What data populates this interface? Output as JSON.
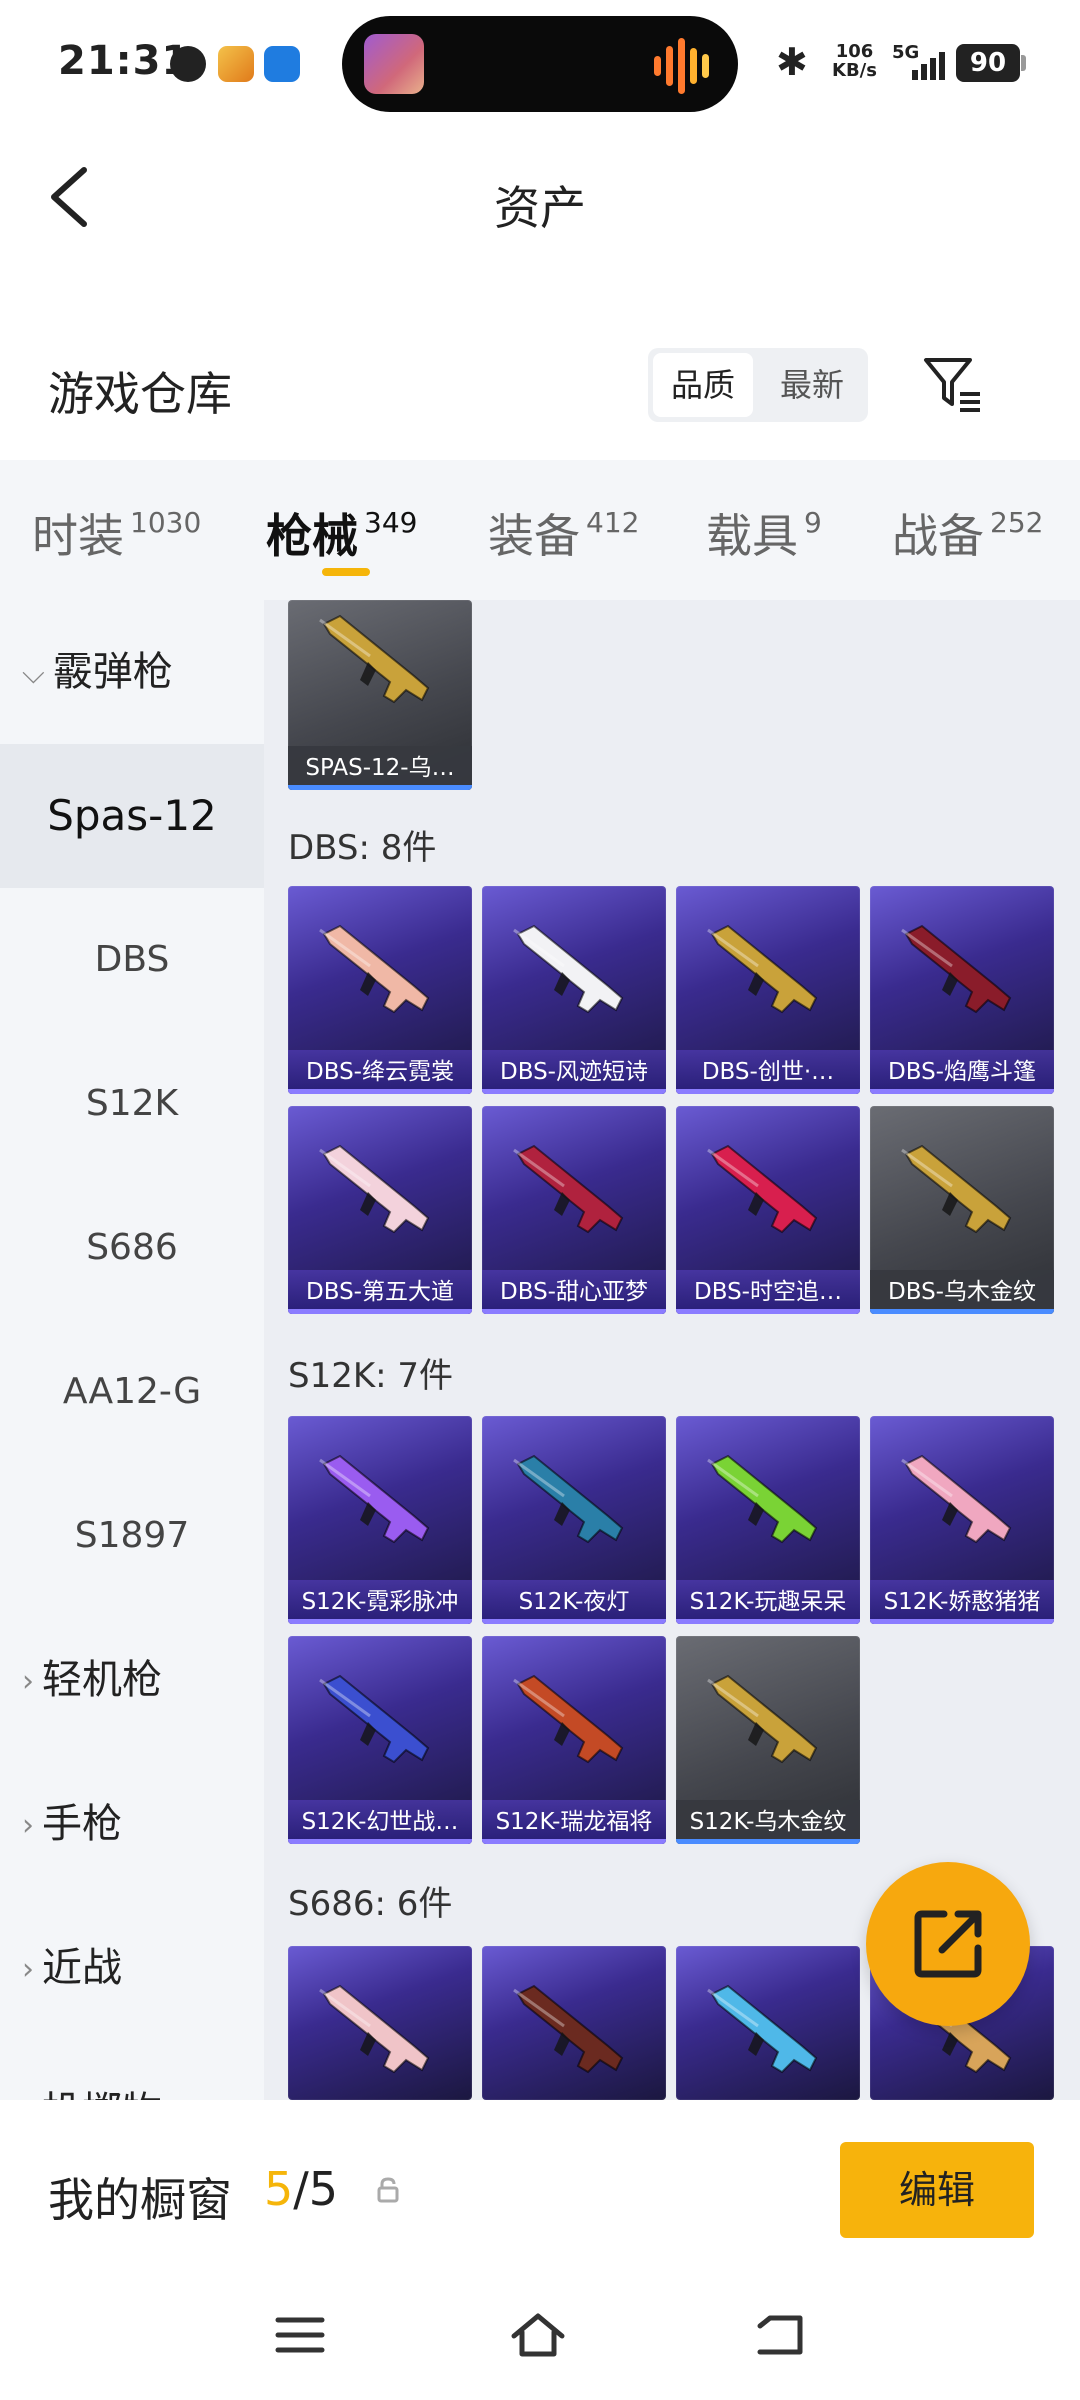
{
  "status_bar": {
    "time": "21:31",
    "speed_value": "106",
    "speed_unit": "KB/s",
    "network": "5G",
    "battery": "90"
  },
  "header": {
    "title": "资产"
  },
  "warehouse": {
    "title": "游戏仓库",
    "sort_options": [
      "品质",
      "最新"
    ],
    "active_sort": "品质"
  },
  "tabs": [
    {
      "label": "时装",
      "count": "1030"
    },
    {
      "label": "枪械",
      "count": "349"
    },
    {
      "label": "装备",
      "count": "412"
    },
    {
      "label": "载具",
      "count": "9"
    },
    {
      "label": "战备",
      "count": "252"
    }
  ],
  "active_tab": "枪械",
  "sidebar": {
    "category_shotgun": "霰弹枪",
    "items": [
      "Spas-12",
      "DBS",
      "S12K",
      "S686",
      "AA12-G",
      "S1897"
    ],
    "category_lmg": "轻机枪",
    "category_pistol": "手枪",
    "category_melee": "近战",
    "category_partial": "投掷物"
  },
  "sections": {
    "spas": {
      "items": [
        {
          "name": "SPAS-12-乌…",
          "quality": "gold",
          "color": "#c9a23a"
        }
      ]
    },
    "dbs": {
      "heading": "DBS: 8件",
      "items": [
        {
          "name": "DBS-绛云霓裳",
          "quality": "purple",
          "color": "#f0b8a6"
        },
        {
          "name": "DBS-风迹短诗",
          "quality": "purple",
          "color": "#f2f2f5"
        },
        {
          "name": "DBS-创世·…",
          "quality": "purple",
          "color": "#c9a23a"
        },
        {
          "name": "DBS-焰鹰斗篷",
          "quality": "purple",
          "color": "#8a1c2a"
        },
        {
          "name": "DBS-第五大道",
          "quality": "purple",
          "color": "#f3d2dc"
        },
        {
          "name": "DBS-甜心亚梦",
          "quality": "purple",
          "color": "#b0223e"
        },
        {
          "name": "DBS-时空追…",
          "quality": "purple",
          "color": "#d81f4e"
        },
        {
          "name": "DBS-乌木金纹",
          "quality": "gold",
          "color": "#c9a23a"
        }
      ]
    },
    "s12k": {
      "heading": "S12K: 7件",
      "items": [
        {
          "name": "S12K-霓彩脉冲",
          "quality": "purple",
          "color": "#9a5cf0"
        },
        {
          "name": "S12K-夜灯",
          "quality": "purple",
          "color": "#2a7fa8"
        },
        {
          "name": "S12K-玩趣呆呆",
          "quality": "purple",
          "color": "#7ad335"
        },
        {
          "name": "S12K-娇憨猪猪",
          "quality": "purple",
          "color": "#f0a7c0"
        },
        {
          "name": "S12K-幻世战…",
          "quality": "purple",
          "color": "#3b4fd0"
        },
        {
          "name": "S12K-瑞龙福将",
          "quality": "purple",
          "color": "#c44a25"
        },
        {
          "name": "S12K-乌木金纹",
          "quality": "gold",
          "color": "#c9a23a"
        }
      ]
    },
    "s686": {
      "heading": "S686: 6件",
      "items": [
        {
          "name": "",
          "quality": "purple",
          "color": "#f0c4c8"
        },
        {
          "name": "",
          "quality": "purple",
          "color": "#6b2a20"
        },
        {
          "name": "",
          "quality": "purple",
          "color": "#4fb8e8"
        },
        {
          "name": "",
          "quality": "purple",
          "color": "#d8a45a"
        }
      ]
    }
  },
  "bottom": {
    "showcase_label": "我的橱窗",
    "showcase_current": "5",
    "showcase_total": "/5",
    "edit_label": "编辑"
  },
  "colors": {
    "accent": "#f7b30c",
    "tab_indicator": "#f5b50a",
    "purple_card": "#3a2b8f",
    "gold_card": "#45474e"
  }
}
